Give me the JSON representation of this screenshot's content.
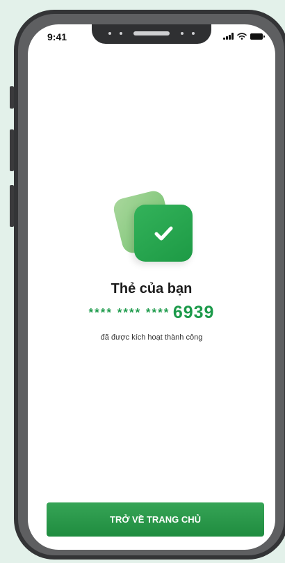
{
  "status_bar": {
    "time": "9:41"
  },
  "content": {
    "title": "Thẻ của bạn",
    "card_mask": "**** **** ****",
    "card_last4": "6939",
    "subtitle": "đã được kích hoạt thành công"
  },
  "actions": {
    "home_button": "TRỞ VỀ TRANG CHỦ"
  },
  "icons": {
    "check": "checkmark-icon",
    "signal": "cellular-signal-icon",
    "wifi": "wifi-icon",
    "battery": "battery-icon"
  },
  "colors": {
    "accent": "#1c9a4a",
    "button": "#2a9a4b",
    "background": "#e3f1ea"
  }
}
